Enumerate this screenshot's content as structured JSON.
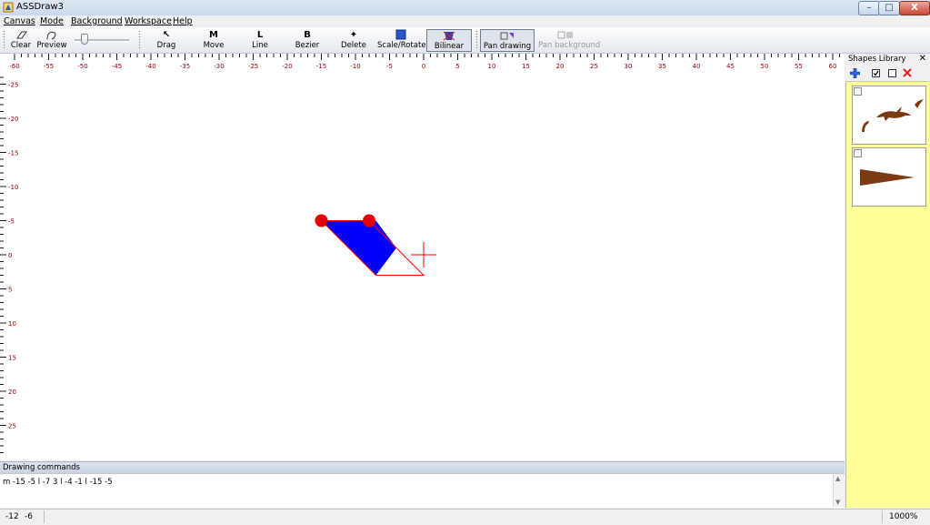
{
  "window": {
    "title": "ASSDraw3",
    "controls": {
      "minimize": "–",
      "maximize": "□",
      "close": "X"
    }
  },
  "menu": [
    "Canvas",
    "Mode",
    "Background",
    "Workspace",
    "Help"
  ],
  "toolbar": {
    "clear": "Clear",
    "preview": "Preview",
    "zoom_level": 0.2,
    "drag": "Drag",
    "move": "Move",
    "move_icon": "M",
    "line": "Line",
    "line_icon": "L",
    "bezier": "Bezier",
    "bezier_icon": "B",
    "delete": "Delete",
    "scale_rotate": "Scale/Rotate",
    "bilinear": "Bilinear",
    "pan_drawing": "Pan drawing",
    "pan_background": "Pan background"
  },
  "rulers": {
    "horizontal": [
      "-60",
      "-55",
      "-50",
      "-45",
      "-40",
      "-35",
      "-30",
      "-25",
      "-20",
      "-15",
      "-10",
      "-5",
      "0",
      "5",
      "10",
      "15",
      "20",
      "25",
      "30",
      "35",
      "40",
      "45",
      "50",
      "55",
      "60"
    ],
    "vertical": [
      "-25",
      "-20",
      "-15",
      "-10",
      "-5",
      "0",
      "5",
      "10",
      "15",
      "20",
      "25"
    ]
  },
  "canvas": {
    "shape_fill": "#0000ff",
    "outline_color": "#ff0000",
    "control_point_color": "#e00000",
    "drawing_points": [
      [
        -15,
        -5
      ],
      [
        -7,
        -5
      ],
      [
        -4,
        -1
      ],
      [
        -7,
        3
      ],
      [
        -15,
        -5
      ]
    ],
    "control_points": [
      [
        -15,
        -5
      ],
      [
        -8,
        -5
      ]
    ],
    "bounding_polygon": [
      [
        -15,
        -5
      ],
      [
        -8,
        -5
      ],
      [
        0,
        3
      ],
      [
        -7,
        3
      ]
    ],
    "cursor_crosshair": [
      0,
      0
    ]
  },
  "commands": {
    "header": "Drawing commands",
    "text": "m -15 -5 l -7 3 l -4 -1 l -15 -5"
  },
  "shapes_library": {
    "title": "Shapes Library",
    "close": "✕",
    "shape_color": "#7b3a10",
    "items": [
      "dolphin-shape",
      "wedge-shape"
    ]
  },
  "status": {
    "x": "-12",
    "y": "-6",
    "zoom": "1000%"
  }
}
